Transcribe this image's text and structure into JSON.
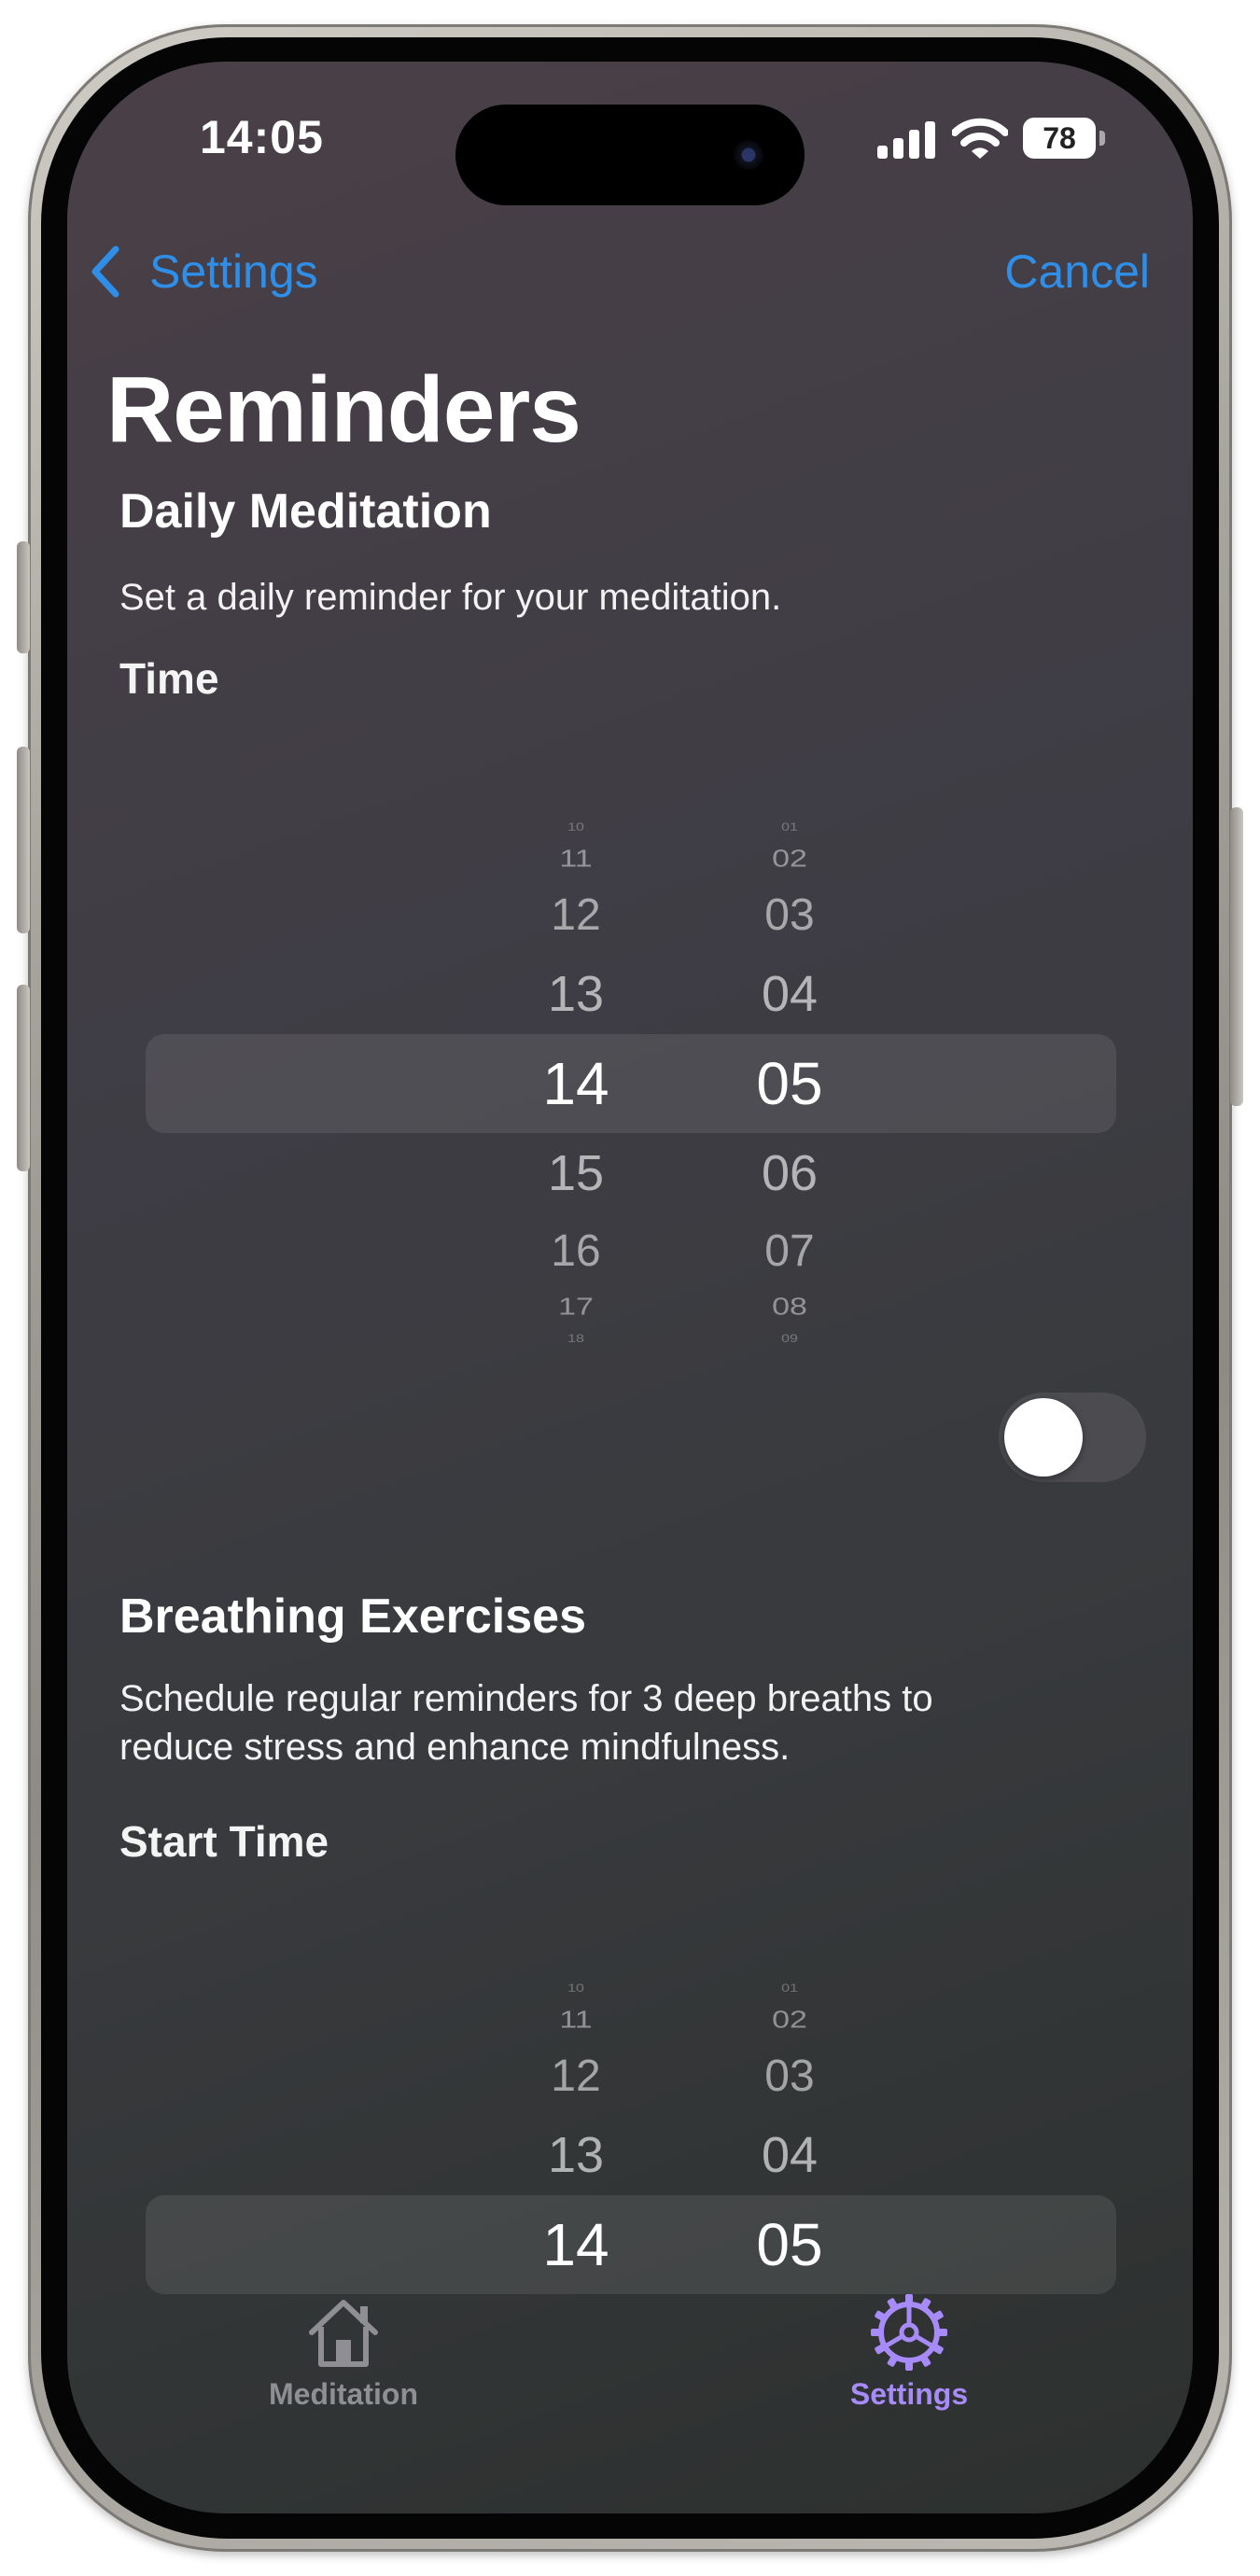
{
  "status_bar": {
    "time": "14:05",
    "battery": "78"
  },
  "nav": {
    "back_label": "Settings",
    "cancel_label": "Cancel"
  },
  "page": {
    "title": "Reminders"
  },
  "daily": {
    "title": "Daily Meditation",
    "description": "Set a daily reminder for your meditation.",
    "time_label": "Time",
    "hours": [
      "10",
      "11",
      "12",
      "13",
      "14",
      "15",
      "16",
      "17",
      "18"
    ],
    "minutes": [
      "01",
      "02",
      "03",
      "04",
      "05",
      "06",
      "07",
      "08",
      "09"
    ],
    "selected_hour": "14",
    "selected_minute": "05",
    "toggle_on": false
  },
  "breathing": {
    "title": "Breathing Exercises",
    "description_line1": "Schedule regular reminders for 3 deep breaths to",
    "description_line2": "reduce stress and enhance mindfulness.",
    "start_time_label": "Start Time",
    "hours": [
      "10",
      "11",
      "12",
      "13",
      "14"
    ],
    "minutes": [
      "01",
      "02",
      "03",
      "04",
      "05"
    ],
    "selected_hour": "14",
    "selected_minute": "05"
  },
  "tabs": [
    {
      "label": "Meditation",
      "icon": "house-icon",
      "active": false
    },
    {
      "label": "Settings",
      "icon": "gear-icon",
      "active": true
    }
  ],
  "colors": {
    "accent_blue": "#2f8fe8",
    "active_tab": "#a78bfa",
    "inactive_tab": "#8e8e93"
  }
}
